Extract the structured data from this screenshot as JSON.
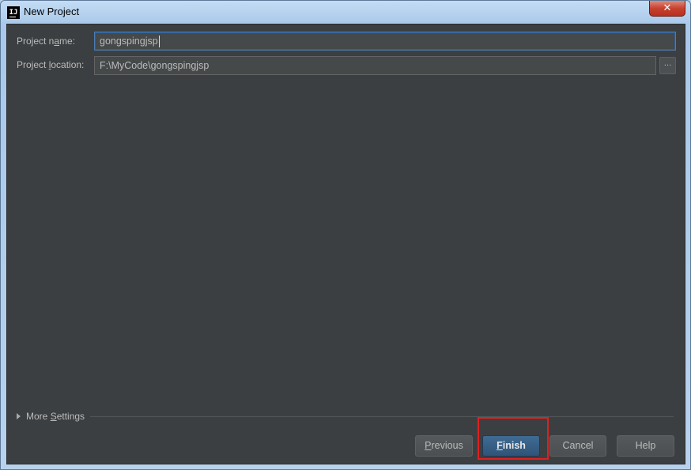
{
  "window": {
    "title": "New Project",
    "app_icon_text": "IJ",
    "close_glyph": "✕"
  },
  "form": {
    "project_name_label_pre": "Project n",
    "project_name_label_u": "a",
    "project_name_label_post": "me:",
    "project_name_value": "gongspingjsp",
    "project_location_label_pre": "Project ",
    "project_location_label_u": "l",
    "project_location_label_post": "ocation:",
    "project_location_value": "F:\\MyCode\\gongspingjsp",
    "browse_label": "..."
  },
  "more_settings": {
    "label_pre": "More ",
    "label_u": "S",
    "label_post": "ettings"
  },
  "buttons": {
    "previous_u": "P",
    "previous_rest": "revious",
    "finish_u": "F",
    "finish_rest": "inish",
    "cancel": "Cancel",
    "help": "Help"
  },
  "colors": {
    "panel_bg": "#3c3f41",
    "text": "#bbbbbb",
    "focus_border": "#4a7cb5",
    "default_button": "#365880",
    "annotation_red": "#e02020"
  },
  "icons": {
    "app": "intellij-icon",
    "close": "close-icon",
    "expand": "triangle-right-icon"
  }
}
